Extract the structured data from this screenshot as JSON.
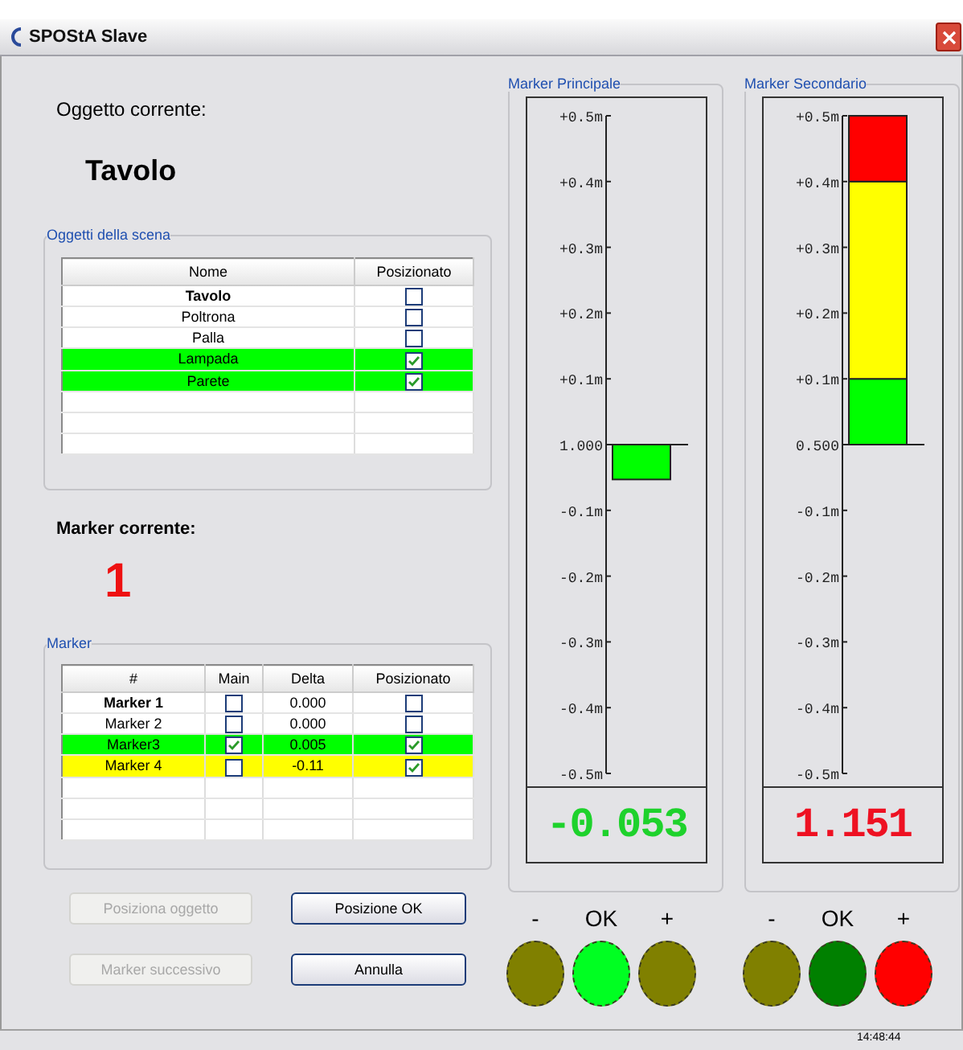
{
  "window": {
    "title": "SPOStA Slave"
  },
  "current_object": {
    "label": "Oggetto corrente:",
    "value": "Tavolo"
  },
  "objects_group": {
    "title": "Oggetti della scena",
    "columns": [
      "Nome",
      "Posizionato"
    ],
    "rows": [
      {
        "name": "Tavolo",
        "current": true,
        "positioned": false,
        "color": "#ffffff"
      },
      {
        "name": "Poltrona",
        "current": false,
        "positioned": false,
        "color": "#ffffff"
      },
      {
        "name": "Palla",
        "current": false,
        "positioned": false,
        "color": "#ffffff"
      },
      {
        "name": "Lampada",
        "current": false,
        "positioned": true,
        "color": "#00ff00"
      },
      {
        "name": "Parete",
        "current": false,
        "positioned": true,
        "color": "#00ff00"
      }
    ]
  },
  "current_marker": {
    "label": "Marker corrente:",
    "value": "1"
  },
  "marker_group": {
    "title": "Marker",
    "columns": [
      "#",
      "Main",
      "Delta",
      "Posizionato"
    ],
    "rows": [
      {
        "name": "Marker 1",
        "current": true,
        "main": false,
        "delta": "0.000",
        "positioned": false,
        "color": "#ffffff"
      },
      {
        "name": "Marker 2",
        "current": false,
        "main": false,
        "delta": "0.000",
        "positioned": false,
        "color": "#ffffff"
      },
      {
        "name": "Marker3",
        "current": false,
        "main": true,
        "delta": "0.005",
        "positioned": true,
        "color": "#00ff00"
      },
      {
        "name": "Marker 4",
        "current": false,
        "main": false,
        "delta": "-0.11",
        "positioned": true,
        "color": "#ffff00"
      }
    ]
  },
  "buttons": [
    {
      "label": "Posiziona oggetto",
      "disabled": true
    },
    {
      "label": "Posizione OK",
      "disabled": false
    },
    {
      "label": "Marker successivo",
      "disabled": true
    },
    {
      "label": "Annulla",
      "disabled": false
    }
  ],
  "gauges": [
    {
      "title": "Marker Principale",
      "reference": "1.000",
      "reading": "-0.053",
      "color": "#1ed22c",
      "chart_data": {
        "type": "bar",
        "stacked": true,
        "ylim": [
          -0.5,
          0.5
        ],
        "yticks": [
          {
            "value": 0.5,
            "label": "+0.5m"
          },
          {
            "value": 0.4,
            "label": "+0.4m"
          },
          {
            "value": 0.3,
            "label": "+0.3m"
          },
          {
            "value": 0.2,
            "label": "+0.2m"
          },
          {
            "value": 0.1,
            "label": "+0.1m"
          },
          {
            "value": -0.1,
            "label": "-0.1m"
          },
          {
            "value": -0.2,
            "label": "-0.2m"
          },
          {
            "value": -0.3,
            "label": "-0.3m"
          },
          {
            "value": -0.4,
            "label": "-0.4m"
          },
          {
            "value": -0.5,
            "label": "-0.5m"
          }
        ],
        "series": [
          {
            "color": "#00ff00",
            "values": [
              -0.053
            ]
          }
        ]
      },
      "lights": [
        {
          "label": "-",
          "color": "#808000"
        },
        {
          "label": "OK",
          "color": "#00ff22"
        },
        {
          "label": "+",
          "color": "#808000"
        }
      ]
    },
    {
      "title": "Marker Secondario",
      "reference": "0.500",
      "reading": "1.151",
      "color": "#ee1122",
      "chart_data": {
        "type": "bar",
        "stacked": true,
        "ylim": [
          -0.5,
          0.5
        ],
        "yticks": [
          {
            "value": 0.5,
            "label": "+0.5m"
          },
          {
            "value": 0.4,
            "label": "+0.4m"
          },
          {
            "value": 0.3,
            "label": "+0.3m"
          },
          {
            "value": 0.2,
            "label": "+0.2m"
          },
          {
            "value": 0.1,
            "label": "+0.1m"
          },
          {
            "value": -0.1,
            "label": "-0.1m"
          },
          {
            "value": -0.2,
            "label": "-0.2m"
          },
          {
            "value": -0.3,
            "label": "-0.3m"
          },
          {
            "value": -0.4,
            "label": "-0.4m"
          },
          {
            "value": -0.5,
            "label": "-0.5m"
          }
        ],
        "series": [
          {
            "color": "#00ff00",
            "values": [
              0.1
            ]
          },
          {
            "color": "#ffff00",
            "values": [
              0.3
            ]
          },
          {
            "color": "#ff0000",
            "values": [
              0.1
            ]
          }
        ]
      },
      "lights": [
        {
          "label": "-",
          "color": "#808000"
        },
        {
          "label": "OK",
          "color": "#008000"
        },
        {
          "label": "+",
          "color": "#ff0000"
        }
      ]
    }
  ],
  "status_bar": {
    "time": "14:48:44"
  }
}
